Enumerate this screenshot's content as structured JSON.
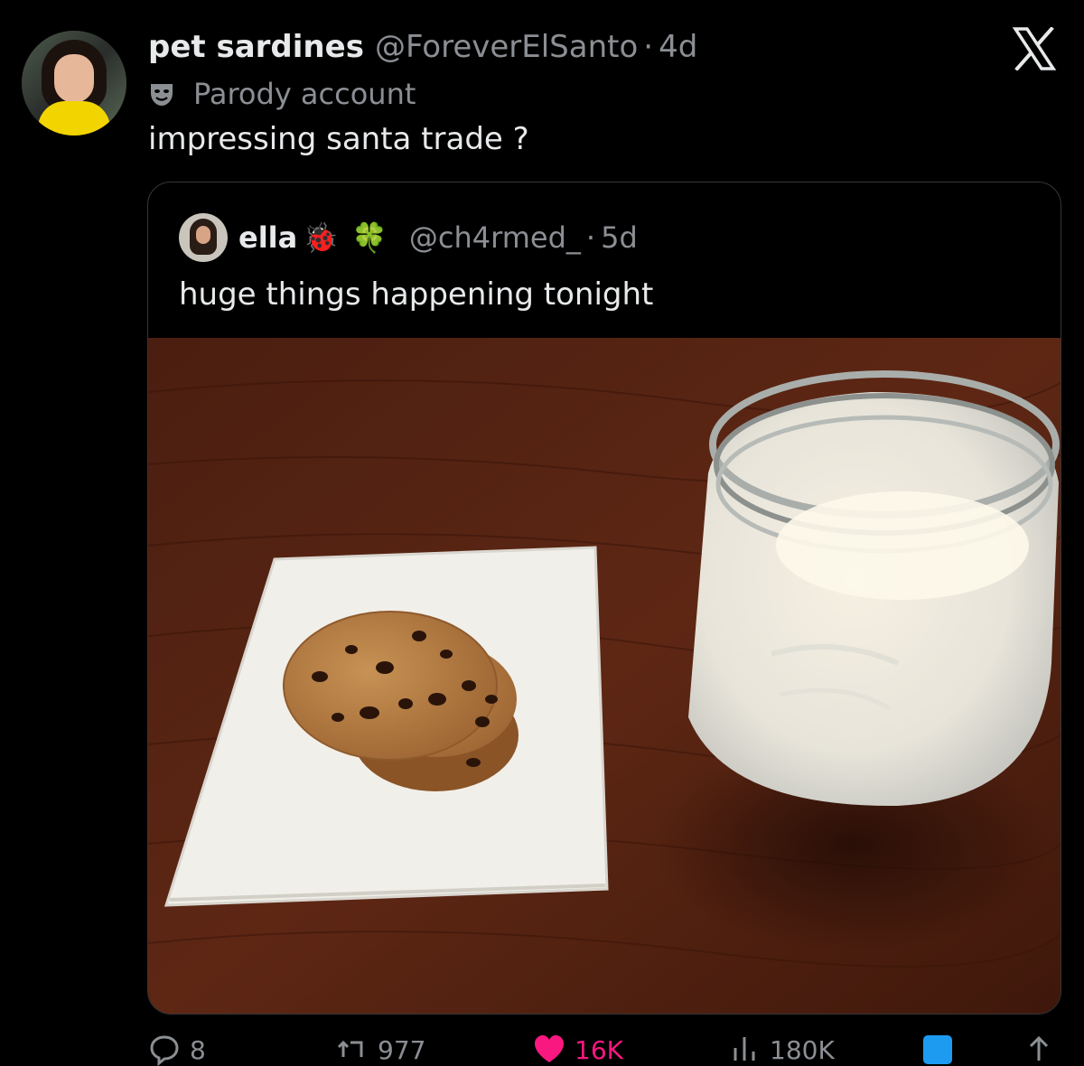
{
  "tweet": {
    "display_name": "pet sardines",
    "handle": "@ForeverElSanto",
    "separator": "·",
    "time": "4d",
    "badge_label": "Parody account",
    "text": "impressing santa trade ?"
  },
  "quoted": {
    "display_name": "ella",
    "emoji_1": "🐞",
    "emoji_2": "🍀",
    "handle": "@ch4rmed_",
    "separator": "·",
    "time": "5d",
    "text": "huge things happening tonight",
    "image_alt": "Chocolate chip cookies on a paper towel next to a mason jar of milk on a wooden table"
  },
  "actions": {
    "replies": "8",
    "reposts": "977",
    "likes": "16K",
    "views": "180K"
  },
  "colors": {
    "background": "#000000",
    "text_primary": "#e7e9ea",
    "text_secondary": "#8b8f94",
    "like_active": "#f91880",
    "bookmark_active": "#1d9bf0"
  },
  "icons": [
    "x-logo-icon",
    "parody-mask-icon",
    "reply-icon",
    "repost-icon",
    "like-icon",
    "views-icon",
    "bookmark-icon",
    "share-icon"
  ]
}
